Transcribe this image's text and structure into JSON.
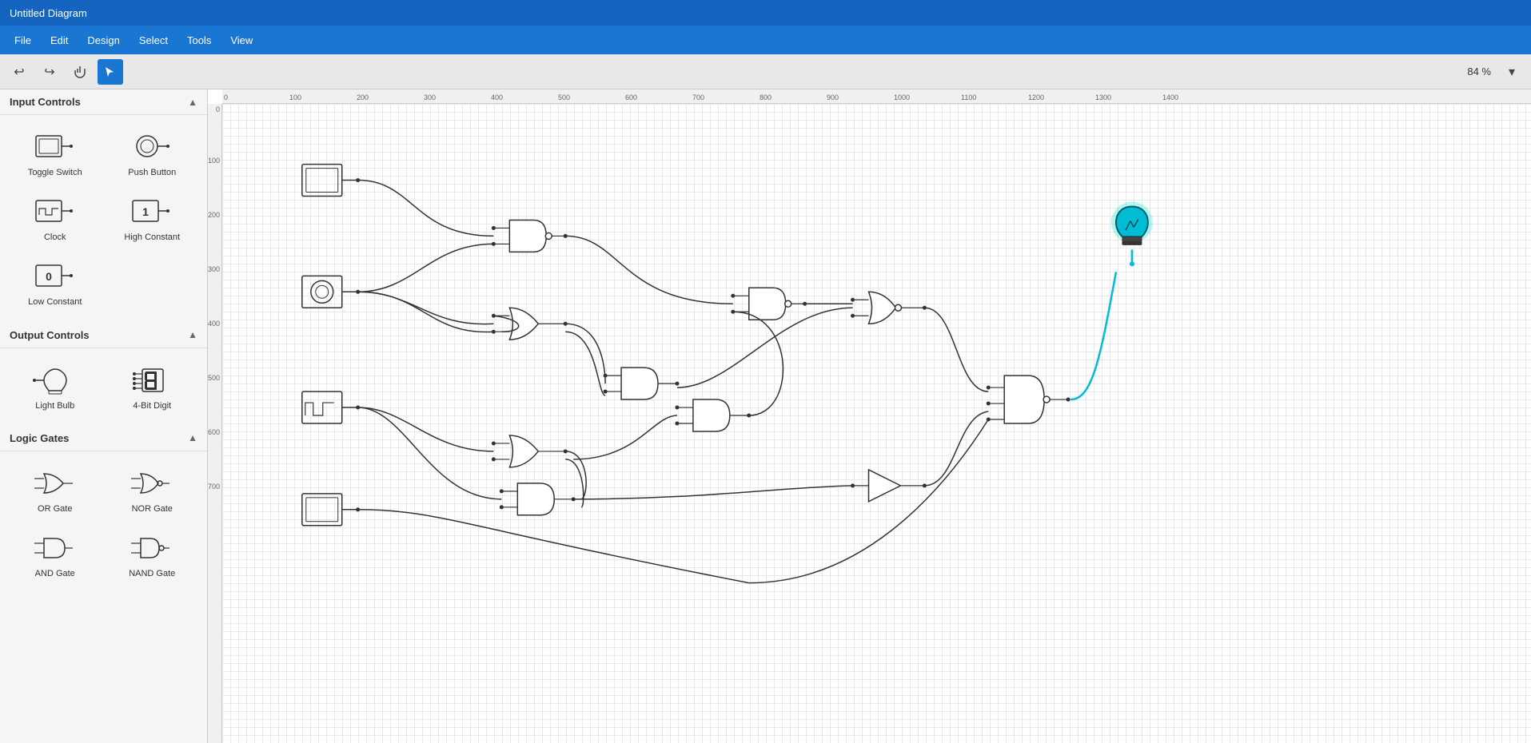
{
  "titlebar": {
    "title": "Untitled Diagram"
  },
  "menubar": {
    "items": [
      "File",
      "Edit",
      "Design",
      "Select",
      "Tools",
      "View"
    ]
  },
  "toolbar": {
    "undo_label": "↩",
    "redo_label": "↪",
    "hand_label": "✋",
    "cursor_label": "↖",
    "zoom_label": "84 %"
  },
  "sidebar": {
    "sections": [
      {
        "id": "input-controls",
        "label": "Input Controls",
        "expanded": true,
        "components": [
          {
            "id": "toggle-switch",
            "label": "Toggle Switch"
          },
          {
            "id": "push-button",
            "label": "Push Button"
          },
          {
            "id": "clock",
            "label": "Clock"
          },
          {
            "id": "high-constant",
            "label": "High Constant"
          },
          {
            "id": "low-constant",
            "label": "Low Constant"
          }
        ]
      },
      {
        "id": "output-controls",
        "label": "Output Controls",
        "expanded": true,
        "components": [
          {
            "id": "light-bulb",
            "label": "Light Bulb"
          },
          {
            "id": "4bit-digit",
            "label": "4-Bit Digit"
          }
        ]
      },
      {
        "id": "logic-gates",
        "label": "Logic Gates",
        "expanded": true,
        "components": [
          {
            "id": "or-gate",
            "label": "OR Gate"
          },
          {
            "id": "nor-gate",
            "label": "NOR Gate"
          },
          {
            "id": "and-gate-2",
            "label": "AND Gate"
          },
          {
            "id": "nand-gate-2",
            "label": "NAND Gate"
          }
        ]
      }
    ]
  },
  "canvas": {
    "ruler_marks_h": [
      0,
      100,
      200,
      300,
      400,
      500,
      600,
      700,
      800,
      900,
      1000,
      1100,
      1200,
      1300,
      1400
    ],
    "ruler_marks_v": [
      0,
      100,
      200,
      300,
      400,
      500,
      600,
      700
    ]
  }
}
